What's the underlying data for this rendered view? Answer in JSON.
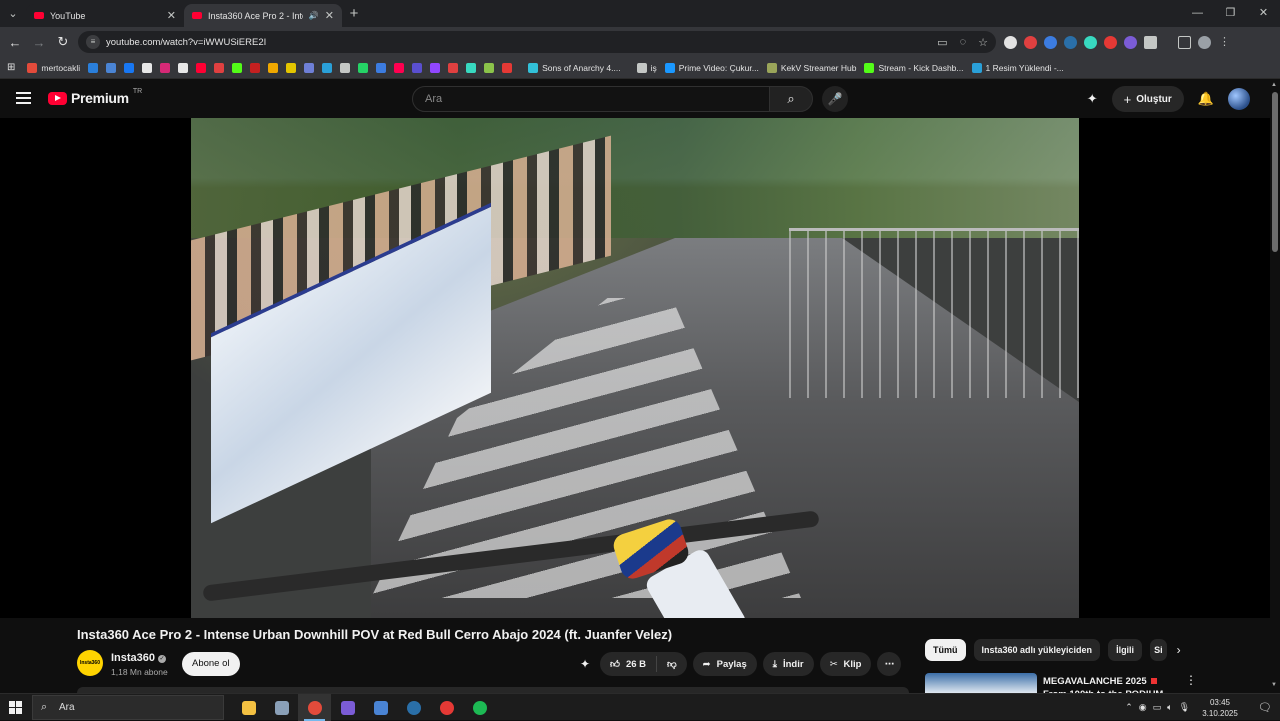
{
  "browser": {
    "tabs": [
      {
        "title": "YouTube",
        "active": false
      },
      {
        "title": "Insta360 Ace Pro 2 - Intense",
        "active": true
      }
    ],
    "url": "youtube.com/watch?v=iWWUSiERE2I",
    "bookmarks": [
      {
        "label": "mertocakli",
        "color": "#e34b3b"
      },
      {
        "label": "",
        "color": "#2a7fdb"
      },
      {
        "label": "",
        "color": "#4a84d4"
      },
      {
        "label": "",
        "color": "#1877f2"
      },
      {
        "label": "",
        "color": "#e8e8e8"
      },
      {
        "label": "",
        "color": "#d62976"
      },
      {
        "label": "",
        "color": "#e8e8e8"
      },
      {
        "label": "",
        "color": "#ff0033"
      },
      {
        "label": "",
        "color": "#e04040"
      },
      {
        "label": "",
        "color": "#53fc18"
      },
      {
        "label": "",
        "color": "#c42020"
      },
      {
        "label": "",
        "color": "#f0a800"
      },
      {
        "label": "",
        "color": "#e3c500"
      },
      {
        "label": "",
        "color": "#6e7fd6"
      },
      {
        "label": "",
        "color": "#2aa0d8"
      },
      {
        "label": "",
        "color": "#c4c7c5"
      },
      {
        "label": "",
        "color": "#25d366"
      },
      {
        "label": "",
        "color": "#3c7ce0"
      },
      {
        "label": "",
        "color": "#ff0050"
      },
      {
        "label": "",
        "color": "#5a4fcf"
      },
      {
        "label": "",
        "color": "#9147ff"
      },
      {
        "label": "",
        "color": "#e04040"
      },
      {
        "label": "",
        "color": "#38d9c0"
      },
      {
        "label": "",
        "color": "#8bc34a"
      },
      {
        "label": "",
        "color": "#e53935"
      },
      {
        "label": "Sons of Anarchy 4....",
        "color": "#32c1d9"
      },
      {
        "label": "iş",
        "color": "#c4c7c5"
      },
      {
        "label": "Prime Video: Çukur...",
        "color": "#1a98ff"
      },
      {
        "label": "KekV Streamer Hub",
        "color": "#9aa55a"
      },
      {
        "label": "Stream - Kick Dashb...",
        "color": "#53fc18"
      },
      {
        "label": "1 Resim Yüklendi -...",
        "color": "#2aa0d8"
      }
    ]
  },
  "youtube": {
    "logo_text": "Premium",
    "country": "TR",
    "search_placeholder": "Ara",
    "create_label": "Oluştur",
    "video": {
      "title": "Insta360 Ace Pro 2 - Intense Urban Downhill POV at Red Bull Cerro Abajo 2024 (ft. Juanfer Velez)",
      "channel": "Insta360",
      "channel_avatar_text": "Insta360",
      "subscribers": "1,18 Mn abone",
      "subscribe_label": "Abone ol",
      "likes": "26 B",
      "share_label": "Paylaş",
      "download_label": "İndir",
      "clip_label": "Klip"
    },
    "chips": [
      {
        "label": "Tümü",
        "selected": true
      },
      {
        "label": "Insta360 adlı yükleyiciden",
        "selected": false
      },
      {
        "label": "İlgili",
        "selected": false
      },
      {
        "label": "Si",
        "selected": false
      }
    ],
    "recommendation": {
      "title_line1": "MEGAVALANCHE 2025",
      "title_line2": "From 100th to the PODIUM"
    }
  },
  "taskbar": {
    "search_placeholder": "Ara",
    "time": "03:45",
    "date": "3.10.2025",
    "apps": [
      {
        "name": "file-explorer",
        "color": "#f4c142"
      },
      {
        "name": "calculator",
        "color": "#8aa0b8"
      },
      {
        "name": "chrome",
        "color": "#e34b3b"
      },
      {
        "name": "app-purple",
        "color": "#7b5cd6"
      },
      {
        "name": "app-blue",
        "color": "#4a84d4"
      },
      {
        "name": "steam",
        "color": "#2a6fa8"
      },
      {
        "name": "app-red",
        "color": "#e53935"
      },
      {
        "name": "spotify",
        "color": "#1db954"
      }
    ]
  }
}
